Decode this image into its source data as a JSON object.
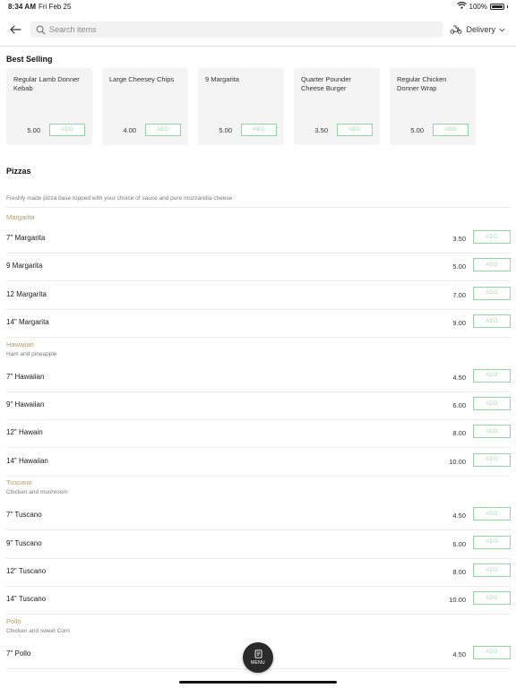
{
  "status_bar": {
    "time": "8:34 AM",
    "date": "Fri Feb 25",
    "battery": "100%"
  },
  "header": {
    "search_placeholder": "Search items",
    "delivery_label": "Delivery"
  },
  "best_selling": {
    "title": "Best Selling",
    "add_label": "ADD",
    "items": [
      {
        "name": "Regular Lamb Donner Kebab",
        "price": "5.00"
      },
      {
        "name": "Large Cheesey Chips",
        "price": "4.00"
      },
      {
        "name": "9 Margarita",
        "price": "5.00"
      },
      {
        "name": "Quarter Pounder Cheese Burger",
        "price": "3.50"
      },
      {
        "name": "Regular Chicken Donner Wrap",
        "price": "5.00"
      }
    ]
  },
  "pizzas": {
    "title": "Pizzas",
    "description": "Freshly made pizza base topped with your choice of sauce and pure mozzarella cheese",
    "add_label": "ADD",
    "groups": [
      {
        "title": "Margarita",
        "subtitle": "",
        "items": [
          {
            "name": "7\" Margarita",
            "price": "3.50"
          },
          {
            "name": "9 Margarita",
            "price": "5.00"
          },
          {
            "name": "12 Margarita",
            "price": "7.00"
          },
          {
            "name": "14\" Margarita",
            "price": "9.00"
          }
        ]
      },
      {
        "title": "Hawaiian",
        "subtitle": "Ham and pineapple",
        "items": [
          {
            "name": "7\" Hawaiian",
            "price": "4.50"
          },
          {
            "name": "9\" Hawaiian",
            "price": "6.00"
          },
          {
            "name": "12\" Hawain",
            "price": "8.00"
          },
          {
            "name": "14\" Hawaiian",
            "price": "10.00"
          }
        ]
      },
      {
        "title": "Tuscano",
        "subtitle": "Chicken and mushroom",
        "items": [
          {
            "name": "7\" Tuscano",
            "price": "4.50"
          },
          {
            "name": "9\" Tuscano",
            "price": "6.00"
          },
          {
            "name": "12\" Tuscano",
            "price": "8.00"
          },
          {
            "name": "14\" Tuscano",
            "price": "10.00"
          }
        ]
      },
      {
        "title": "Pollo",
        "subtitle": "Chicken and sweet Corn",
        "items": [
          {
            "name": "7\" Pollo",
            "price": "4.50"
          }
        ]
      }
    ]
  },
  "menu_button": {
    "label": "MENU"
  },
  "colors": {
    "accent_green": "#8fd6a3",
    "group_title": "#b09a6c",
    "fab": "#2a2a2a"
  }
}
